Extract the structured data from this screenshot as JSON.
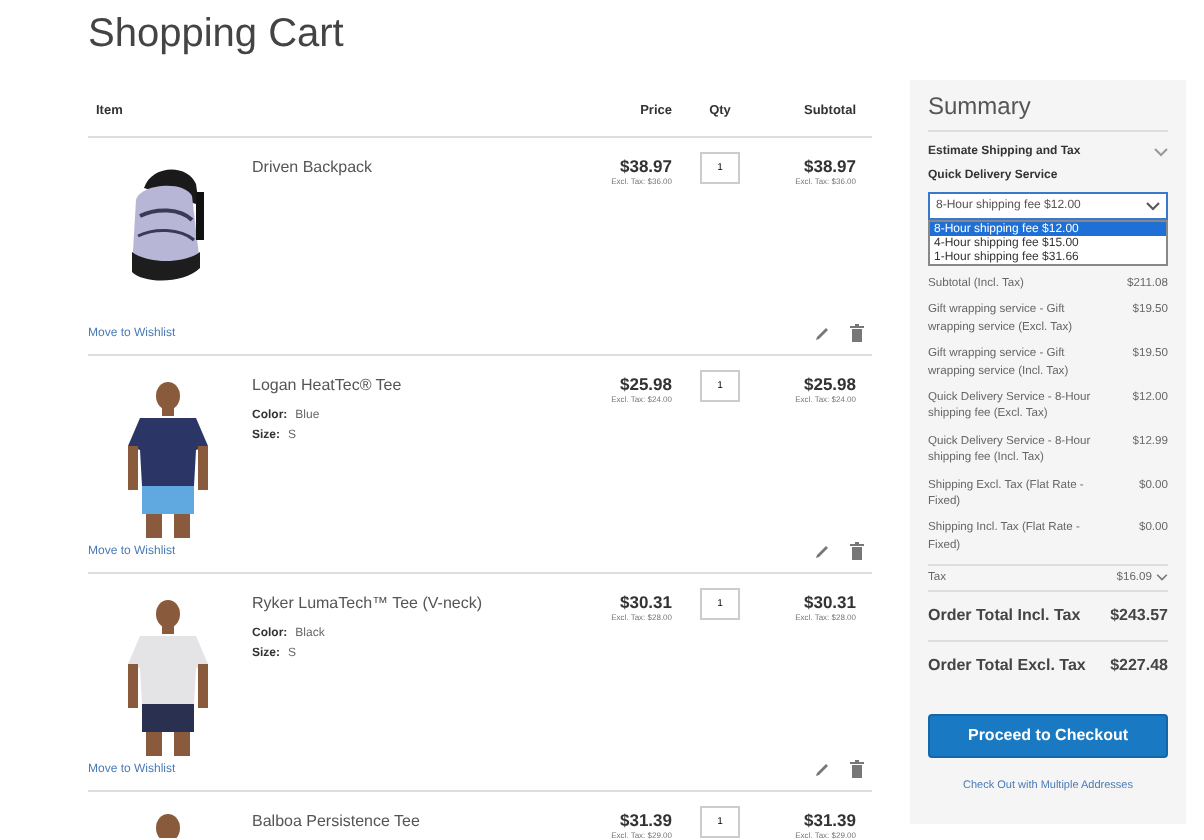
{
  "page_title": "Shopping Cart",
  "table": {
    "columns": [
      "Item",
      "Price",
      "Qty",
      "Subtotal"
    ],
    "rows": [
      {
        "name": "Driven Backpack",
        "price": "$38.97",
        "price_excl": "Excl. Tax: $36.00",
        "qty": "1",
        "subtotal": "$38.97",
        "subtotal_excl": "Excl. Tax: $36.00",
        "options": [],
        "action": "Move to Wishlist"
      },
      {
        "name": "Logan HeatTec® Tee",
        "price": "$25.98",
        "price_excl": "Excl. Tax: $24.00",
        "qty": "1",
        "subtotal": "$25.98",
        "subtotal_excl": "Excl. Tax: $24.00",
        "options": [
          {
            "label": "Color:",
            "value": "Blue"
          },
          {
            "label": "Size:",
            "value": "S"
          }
        ],
        "action": "Move to Wishlist"
      },
      {
        "name": "Ryker LumaTech™ Tee (V-neck)",
        "price": "$30.31",
        "price_excl": "Excl. Tax: $28.00",
        "qty": "1",
        "subtotal": "$30.31",
        "subtotal_excl": "Excl. Tax: $28.00",
        "options": [
          {
            "label": "Color:",
            "value": "Black"
          },
          {
            "label": "Size:",
            "value": "S"
          }
        ],
        "action": "Move to Wishlist"
      },
      {
        "name": "Balboa Persistence Tee",
        "price": "$31.39",
        "price_excl": "Excl. Tax: $29.00",
        "qty": "1",
        "subtotal": "$31.39",
        "subtotal_excl": "Excl. Tax: $29.00",
        "options": []
      }
    ]
  },
  "summary": {
    "title": "Summary",
    "estimate": "Estimate Shipping and Tax",
    "shipping_label": "Quick Delivery Service",
    "select": {
      "value": "8-Hour shipping fee $12.00",
      "expanded": true,
      "options": [
        {
          "label": "8-Hour shipping fee $12.00",
          "selected": true
        },
        {
          "label": "4-Hour shipping fee $15.00",
          "selected": false
        },
        {
          "label": "1-Hour shipping fee $31.66",
          "selected": false
        }
      ]
    },
    "rows": [
      {
        "kind": "line",
        "label": "Subtotal (Incl. Tax)",
        "amount": "$211.08"
      },
      {
        "kind": "line",
        "label": "Gift wrapping service - Gift wrapping service (Excl. Tax)",
        "amount": "$19.50"
      },
      {
        "kind": "line",
        "label": "Gift wrapping service - Gift wrapping service (Incl. Tax)",
        "amount": "$19.50"
      },
      {
        "kind": "line",
        "label": "Quick Delivery Service - 8-Hour shipping fee (Excl. Tax)",
        "amount": "$12.00"
      },
      {
        "kind": "line",
        "label": "Quick Delivery Service - 8-Hour shipping fee (Incl. Tax)",
        "amount": "$12.99"
      },
      {
        "kind": "line",
        "label": "Shipping Excl. Tax (Flat Rate - Fixed)",
        "amount": "$0.00"
      },
      {
        "kind": "line",
        "label": "Shipping Incl. Tax (Flat Rate - Fixed)",
        "amount": "$0.00"
      },
      {
        "kind": "tax",
        "label": "Tax",
        "amount": "$16.09"
      },
      {
        "kind": "total",
        "label": "Order Total Incl. Tax",
        "amount": "$243.57"
      },
      {
        "kind": "total",
        "label": "Order Total Excl. Tax",
        "amount": "$227.48"
      }
    ],
    "checkout": "Proceed to Checkout",
    "multi": "Check Out with Multiple Addresses"
  }
}
